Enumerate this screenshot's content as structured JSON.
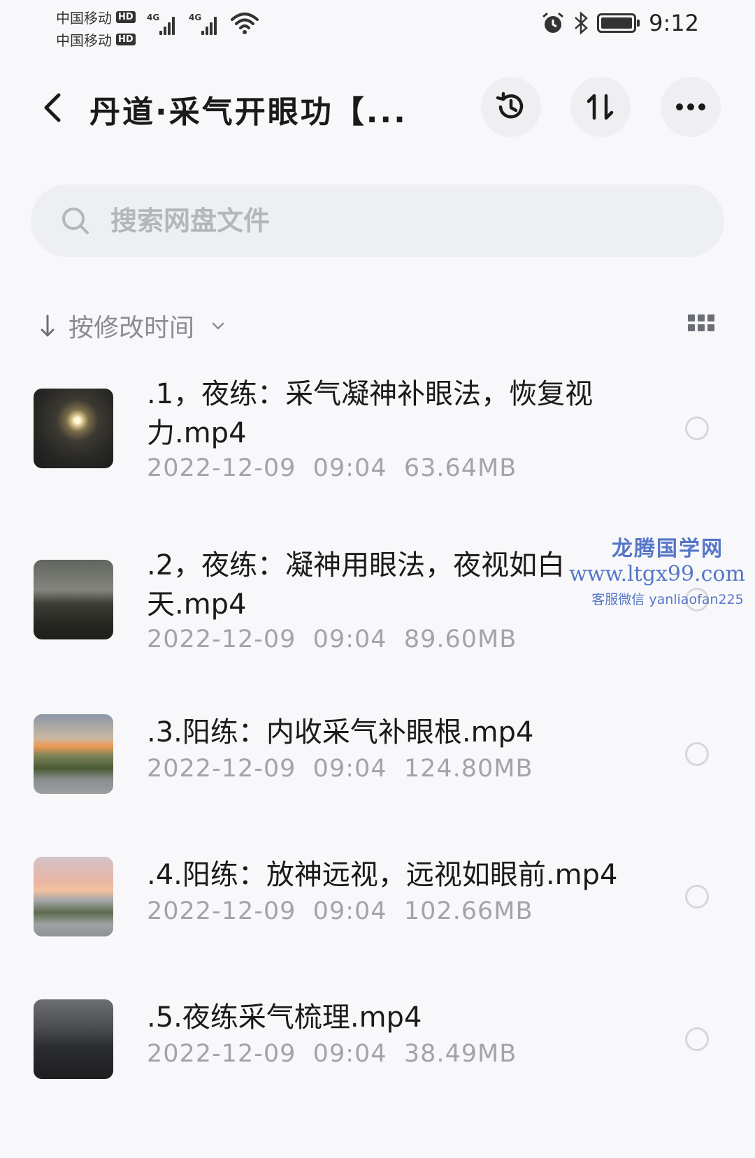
{
  "status_bar": {
    "carrier_1": "中国移动",
    "carrier_2": "中国移动",
    "hd_badge": "HD",
    "network_1": "4G",
    "network_2": "4G",
    "time": "9:12",
    "icons": [
      "signal-icon",
      "wifi-icon",
      "alarm-icon",
      "bluetooth-icon",
      "battery-icon"
    ]
  },
  "header": {
    "title": "丹道·采气开眼功【...",
    "actions": [
      "history-icon",
      "sort-icon",
      "more-icon"
    ]
  },
  "search": {
    "placeholder": "搜索网盘文件"
  },
  "sort": {
    "label": "按修改时间"
  },
  "files": [
    {
      "name": ".1，夜练：采气凝神补眼法，恢复视力.mp4",
      "date": "2022-12-09",
      "time": "09:04",
      "size": "63.64MB",
      "selected": false
    },
    {
      "name": ".2，夜练：凝神用眼法，夜视如白天.mp4",
      "date": "2022-12-09",
      "time": "09:04",
      "size": "89.60MB",
      "selected": false
    },
    {
      "name": ".3.阳练：内收采气补眼根.mp4",
      "date": "2022-12-09",
      "time": "09:04",
      "size": "124.80MB",
      "selected": false
    },
    {
      "name": ".4.阳练：放神远视，远视如眼前.mp4",
      "date": "2022-12-09",
      "time": "09:04",
      "size": "102.66MB",
      "selected": false
    },
    {
      "name": ".5.夜练采气梳理.mp4",
      "date": "2022-12-09",
      "time": "09:04",
      "size": "38.49MB",
      "selected": false
    }
  ],
  "watermark": {
    "title": "龙腾国学网",
    "url": "www.ltgx99.com",
    "contact": "客服微信 yanliaofan225"
  },
  "colors": {
    "background": "#f8f8fa",
    "search_background": "#eeeff2",
    "secondary_text": "#a2a4aa",
    "watermark": "#5676c8"
  }
}
